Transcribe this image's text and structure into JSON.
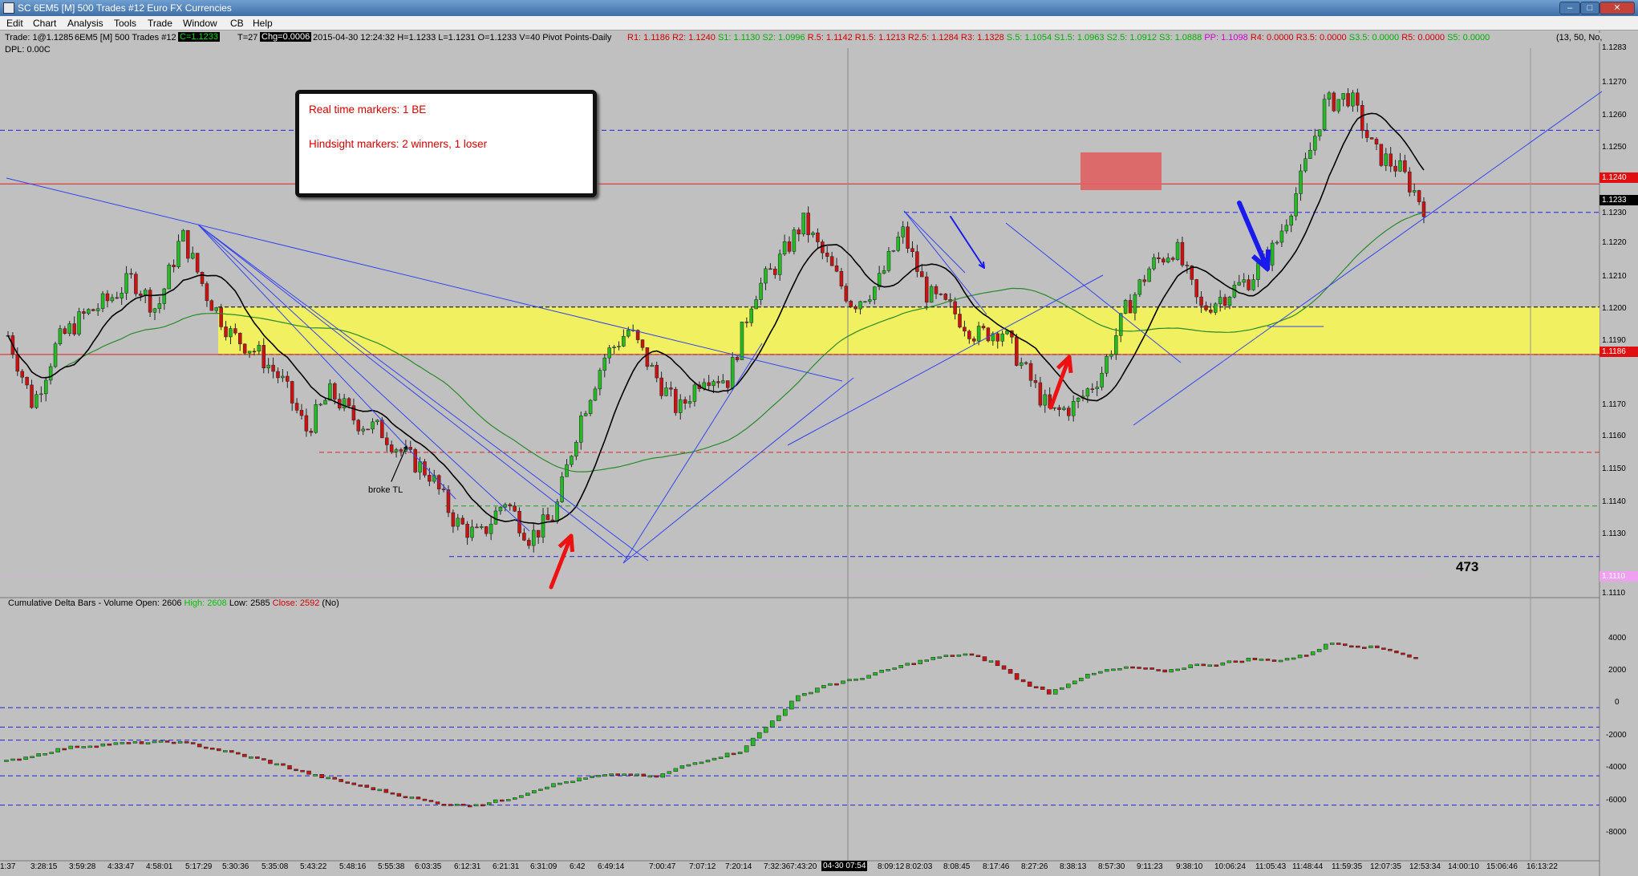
{
  "window": {
    "title": "SC 6EM5 [M]  500 Trades  #12  Euro FX Currencies",
    "min": "–",
    "max": "□",
    "close": "✕"
  },
  "menu": [
    "Edit",
    "Chart",
    "Analysis",
    "Tools",
    "Trade",
    "Window",
    "CB",
    "Help"
  ],
  "header": {
    "trade": "Trade: 1@1.1285",
    "symbol": "6EM5 [M]  500 Trades  #12",
    "c_box": "C=1.1233",
    "t_count": "T=27",
    "chg_box": "Chg=0.0006",
    "ohlc": "2015-04-30 12:24:32 H=1.1233 L=1.1231 O=1.1233 V=40 Pivot Points-Daily",
    "dpl": "DPL: 0.00C",
    "params": "(13, 50, No,",
    "pivots": [
      {
        "label": "R1: 1.1186",
        "color": "#d00000"
      },
      {
        "label": "R2: 1.1240",
        "color": "#d00000"
      },
      {
        "label": "S1: 1.1130",
        "color": "#00b000"
      },
      {
        "label": "S2: 1.0996",
        "color": "#00b000"
      },
      {
        "label": "R.5: 1.1142",
        "color": "#d00000"
      },
      {
        "label": "R1.5: 1.1213",
        "color": "#d00000"
      },
      {
        "label": "R2.5: 1.1284",
        "color": "#d00000"
      },
      {
        "label": "R3: 1.1328",
        "color": "#d00000"
      },
      {
        "label": "S.5: 1.1054",
        "color": "#00b000"
      },
      {
        "label": "S1.5: 1.0963",
        "color": "#00b000"
      },
      {
        "label": "S2.5: 1.0912",
        "color": "#00b000"
      },
      {
        "label": "S3: 1.0888",
        "color": "#00b000"
      },
      {
        "label": "PP: 1.1098",
        "color": "#d000d0"
      },
      {
        "label": "R4: 0.0000",
        "color": "#d00000"
      },
      {
        "label": "R3.5: 0.0000",
        "color": "#d00000"
      },
      {
        "label": "S3.5: 0.0000",
        "color": "#00b000"
      },
      {
        "label": "R5: 0.0000",
        "color": "#d00000"
      },
      {
        "label": "S5: 0.0000",
        "color": "#00b000"
      }
    ]
  },
  "price_axis": [
    "1.1270",
    "1.1260",
    "1.1250",
    "1.1230",
    "1.1220",
    "1.1210",
    "1.1200",
    "1.1190",
    "1.1170",
    "1.1160",
    "1.1150",
    "1.1140",
    "1.1130"
  ],
  "price_top_clipped": "1.1283",
  "price_bottom_clipped": "1.1110",
  "price_markers": {
    "r2": "1.1240",
    "last": "1.1233",
    "r1": "1.1186",
    "bottom": "1.1110"
  },
  "delta_axis": [
    "4000",
    "2000",
    "0",
    "-2000",
    "-4000",
    "-6000",
    "-8000"
  ],
  "time_axis": [
    "1:37",
    "3:28:15",
    "3:59:28",
    "4:33:47",
    "4:58:01",
    "5:17:29",
    "5:30:36",
    "5:35:08",
    "5:43:22",
    "5:48:16",
    "5:55:38",
    "6:03:35",
    "6:12:31",
    "6:21:31",
    "6:31:09",
    "6:42",
    "6:49:14",
    "7:00:47",
    "7:07:12",
    "7:20:14",
    "7:32:36",
    "7:43:20",
    "04-30  07:54",
    "8:09:12",
    "8:02:03",
    "8:08:45",
    "8:17:46",
    "8:27:26",
    "8:38:13",
    "8:57:30",
    "9:11:23",
    "9:38:10",
    "10:06:24",
    "11:05:43",
    "11:48:44",
    "11:59:35",
    "12:07:35",
    "12:53:34",
    "14:00:10",
    "15:06:46",
    "16:13:22"
  ],
  "annotation": {
    "line1": "Real time markers: 1 BE",
    "line2": "Hindsight markers: 2 winners, 1 loser"
  },
  "chart_labels": {
    "broke_tl": "broke TL",
    "bar_count": "473"
  },
  "delta_study": {
    "name": "Cumulative Delta Bars - Volume",
    "open": "Open: 2606",
    "high": "High: 2608",
    "low": "Low: 2585",
    "close": "Close: 2592",
    "flag": "(No)"
  },
  "colors": {
    "up": "#22bb22",
    "down": "#cc1111",
    "zone": "#f0f060",
    "pivot_blue": "#2222dd",
    "ma": "#000000",
    "long_ma": "#2a8a2a"
  },
  "chart_data": [
    {
      "type": "candlestick",
      "title": "6EM5 [M] 500 Trades #12 Euro FX Currencies",
      "ylim": [
        1.111,
        1.1283
      ],
      "x_start": "03:28:15",
      "x_end": "12:24:32",
      "last_price": 1.1233,
      "horizontal_levels": [
        {
          "name": "R2",
          "value": 1.124,
          "color": "#d00000"
        },
        {
          "name": "R1",
          "value": 1.1186,
          "color": "#d00000"
        },
        {
          "name": "S1",
          "value": 1.113,
          "color": "#00b000"
        },
        {
          "name": "R.5",
          "value": 1.1142,
          "color": "#d00000"
        }
      ],
      "supply_demand_zone": [
        1.1186,
        1.1201
      ],
      "close_path": [
        1.1192,
        1.117,
        1.119,
        1.1198,
        1.1203,
        1.121,
        1.12,
        1.1224,
        1.1205,
        1.1192,
        1.1187,
        1.1178,
        1.1162,
        1.1174,
        1.1165,
        1.1162,
        1.1154,
        1.1148,
        1.1133,
        1.1128,
        1.114,
        1.1128,
        1.1135,
        1.1165,
        1.1185,
        1.1194,
        1.118,
        1.1168,
        1.118,
        1.1178,
        1.1205,
        1.1215,
        1.1228,
        1.1215,
        1.1202,
        1.1208,
        1.1225,
        1.1205,
        1.12,
        1.1192,
        1.1194,
        1.118,
        1.1167,
        1.117,
        1.118,
        1.12,
        1.1214,
        1.122,
        1.12,
        1.1205,
        1.121,
        1.122,
        1.124,
        1.1265,
        1.1268,
        1.125,
        1.1245,
        1.1233
      ]
    },
    {
      "type": "line",
      "title": "Cumulative Delta Bars - Volume",
      "ylim": [
        -9000,
        5000
      ],
      "open": 2606,
      "high": 2608,
      "low": 2585,
      "close": 2592,
      "values": [
        -3700,
        -3300,
        -2900,
        -2700,
        -2600,
        -2550,
        -2500,
        -2800,
        -3200,
        -3600,
        -4100,
        -4600,
        -5000,
        -5400,
        -5800,
        -6200,
        -6400,
        -6300,
        -5900,
        -5300,
        -4900,
        -4600,
        -4500,
        -4700,
        -4000,
        -3500,
        -3100,
        -1500,
        200,
        1000,
        1300,
        1800,
        2300,
        2700,
        2900,
        2400,
        1200,
        500,
        1400,
        1900,
        2100,
        1800,
        2200,
        2300,
        2600,
        2500,
        2800,
        3600,
        3400,
        3200,
        2600
      ]
    }
  ]
}
